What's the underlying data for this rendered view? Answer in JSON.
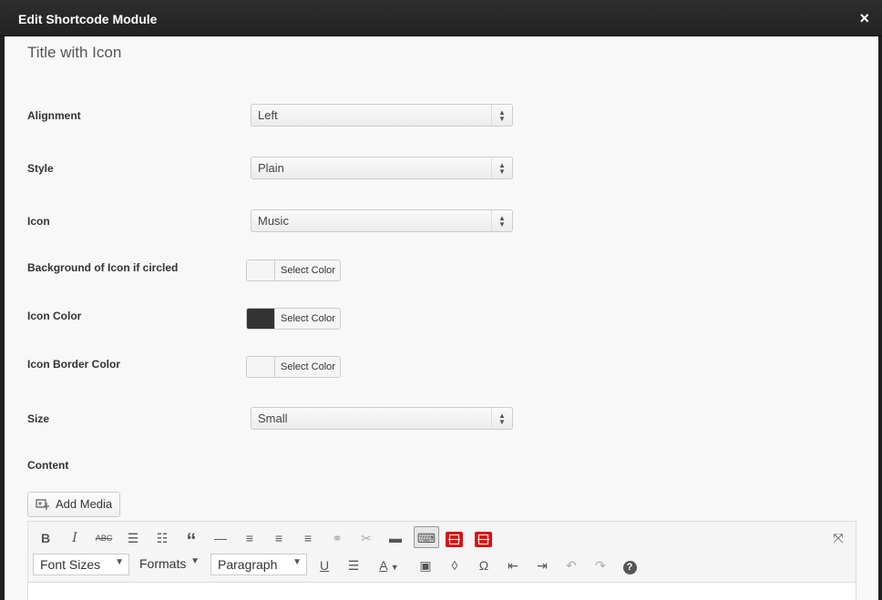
{
  "header": {
    "title": "Edit Shortcode Module",
    "close_label": "×"
  },
  "module_title": "Title with Icon",
  "fields": {
    "alignment": {
      "label": "Alignment",
      "value": "Left"
    },
    "style": {
      "label": "Style",
      "value": "Plain"
    },
    "icon": {
      "label": "Icon",
      "value": "Music"
    },
    "bg_icon": {
      "label": "Background of Icon if circled",
      "button": "Select Color",
      "color": "#f5f5f5"
    },
    "icon_color": {
      "label": "Icon Color",
      "button": "Select Color",
      "color": "#333333"
    },
    "icon_border": {
      "label": "Icon Border Color",
      "button": "Select Color",
      "color": "#f5f5f5"
    },
    "size": {
      "label": "Size",
      "value": "Small"
    },
    "content": {
      "label": "Content"
    }
  },
  "editor": {
    "add_media_label": "Add Media",
    "font_sizes_label": "Font Sizes",
    "formats_label": "Formats",
    "paragraph_label": "Paragraph",
    "toolbar_row1": [
      "bold-icon",
      "italic-icon",
      "strikethrough-icon",
      "bullet-list-icon",
      "numbered-list-icon",
      "blockquote-icon",
      "horizontal-rule-icon",
      "align-left-icon",
      "align-center-icon",
      "align-right-icon",
      "link-icon",
      "unlink-icon",
      "read-more-icon",
      "toolbar-toggle-icon",
      "shortcode-icon",
      "shortcode-icon",
      "fullscreen-icon"
    ],
    "toolbar_row2": [
      "underline-icon",
      "justify-icon",
      "text-color-icon",
      "paste-text-icon",
      "clear-formatting-icon",
      "special-character-icon",
      "outdent-icon",
      "indent-icon",
      "undo-icon",
      "redo-icon",
      "help-icon"
    ]
  }
}
